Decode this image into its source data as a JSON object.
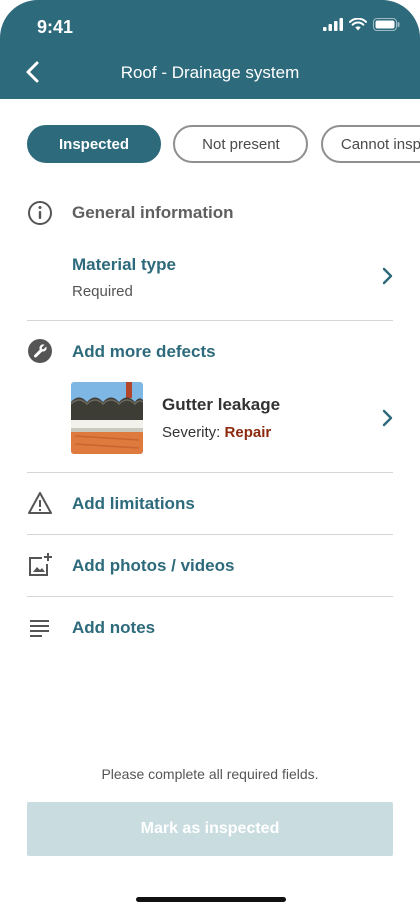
{
  "status_bar": {
    "time": "9:41"
  },
  "header": {
    "title": "Roof - Drainage system"
  },
  "status_tabs": [
    {
      "label": "Inspected",
      "selected": true
    },
    {
      "label": "Not present",
      "selected": false
    },
    {
      "label": "Cannot inspect",
      "selected": false
    }
  ],
  "general_info": {
    "title": "General information",
    "icon": "info-icon"
  },
  "material": {
    "title": "Material type",
    "subtitle": "Required"
  },
  "defects": {
    "title": "Add more defects",
    "icon": "wrench-icon",
    "items": [
      {
        "name": "Gutter leakage",
        "severity_label": "Severity:",
        "severity_value": "Repair"
      }
    ]
  },
  "limitations": {
    "title": "Add limitations",
    "icon": "warning-icon"
  },
  "photos": {
    "title": "Add photos / videos",
    "icon": "add-photo-icon"
  },
  "notes": {
    "title": "Add notes",
    "icon": "notes-icon"
  },
  "footer": {
    "message": "Please complete all required fields.",
    "button_label": "Mark as inspected"
  },
  "colors": {
    "primary": "#2d6a7b",
    "severity_repair": "#8b2a0e",
    "disabled_button": "#c9dde1"
  }
}
